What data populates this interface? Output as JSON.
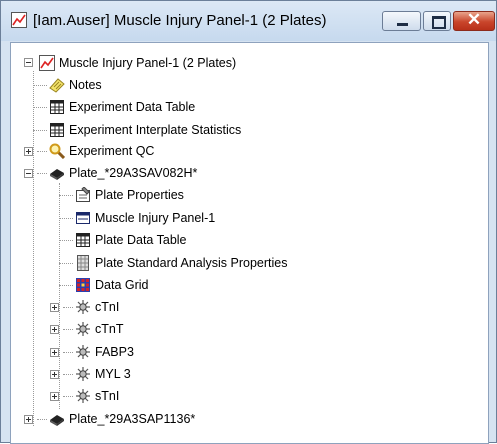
{
  "window": {
    "title": "[Iam.Auser] Muscle Injury Panel-1 (2 Plates)",
    "close_glyph": "✕"
  },
  "tree": {
    "root": "Muscle Injury Panel-1 (2 Plates)",
    "notes": "Notes",
    "exp_data_table": "Experiment Data Table",
    "exp_interplate": "Experiment Interplate Statistics",
    "exp_qc": "Experiment QC",
    "plate1": "Plate_*29A3SAV082H*",
    "plate_properties": "Plate Properties",
    "panel": "Muscle Injury Panel-1",
    "plate_data_table": "Plate Data Table",
    "plate_std_analysis": "Plate Standard Analysis Properties",
    "data_grid": "Data Grid",
    "analytes": [
      "cTnI",
      "cTnT",
      "FABP3",
      "MYL 3",
      "sTnI"
    ],
    "plate2": "Plate_*29A3SAP1136*"
  },
  "icons": {
    "root": "panel-chart-icon",
    "notes": "notes-icon",
    "table": "table-icon",
    "qc": "magnifier-icon",
    "plate": "plate-icon",
    "plate_properties": "properties-icon",
    "panel": "panel-layout-icon",
    "std_analysis": "analysis-grid-icon",
    "data_grid": "data-grid-icon",
    "analyte": "analyte-icon"
  },
  "colors": {
    "title_bar": "#c6d9ee",
    "close_button": "#c9452b",
    "tree_background": "#ffffff",
    "data_grid_red": "#d2232a",
    "data_grid_blue": "#2c3fae"
  }
}
